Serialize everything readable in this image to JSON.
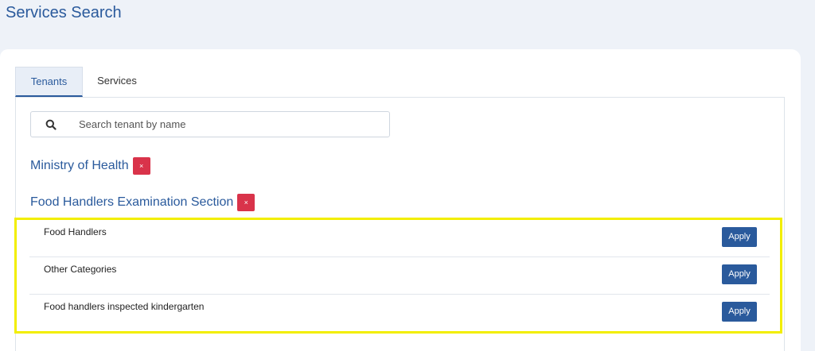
{
  "page": {
    "title": "Services Search"
  },
  "tabs": [
    {
      "label": "Tenants",
      "active": true
    },
    {
      "label": "Services",
      "active": false
    }
  ],
  "search": {
    "placeholder": "Search tenant by name",
    "value": ""
  },
  "tenants": [
    {
      "name": "Ministry of Health",
      "remove_label": "×"
    },
    {
      "name": "Food Handlers Examination Section",
      "remove_label": "×"
    }
  ],
  "services": [
    {
      "label": "Food Handlers",
      "action": "Apply"
    },
    {
      "label": "Other Categories",
      "action": "Apply"
    },
    {
      "label": "Food handlers inspected kindergarten",
      "action": "Apply"
    }
  ],
  "colors": {
    "accent": "#2a5a9c",
    "remove": "#d9334a",
    "highlight": "#f2ee00",
    "background": "#eef2f8"
  },
  "icons": {
    "search": "search-icon",
    "remove": "close-icon"
  }
}
